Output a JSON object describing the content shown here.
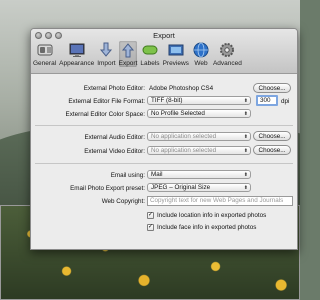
{
  "window": {
    "title": "Export"
  },
  "toolbar": {
    "items": [
      {
        "label": "General",
        "icon": "switch-icon"
      },
      {
        "label": "Appearance",
        "icon": "display-icon"
      },
      {
        "label": "Import",
        "icon": "import-arrow-icon"
      },
      {
        "label": "Export",
        "icon": "export-arrow-icon"
      },
      {
        "label": "Labels",
        "icon": "labels-icon"
      },
      {
        "label": "Previews",
        "icon": "previews-icon"
      },
      {
        "label": "Web",
        "icon": "globe-icon"
      },
      {
        "label": "Advanced",
        "icon": "gear-icon"
      }
    ],
    "active": "Export"
  },
  "editor": {
    "photo_editor_label": "External Photo Editor:",
    "photo_editor_value": "Adobe Photoshop CS4",
    "choose_label": "Choose...",
    "file_format_label": "External Editor File Format:",
    "file_format_value": "TIFF (8-bit)",
    "dpi_value": "300",
    "dpi_unit": "dpi",
    "color_space_label": "External Editor Color Space:",
    "color_space_value": "No Profile Selected"
  },
  "audio_video": {
    "audio_label": "External Audio Editor:",
    "audio_value": "No application selected",
    "video_label": "External Video Editor:",
    "video_value": "No application selected",
    "choose_label": "Choose..."
  },
  "email": {
    "email_using_label": "Email using:",
    "email_using_value": "Mail",
    "export_preset_label": "Email Photo Export preset:",
    "export_preset_value": "JPEG – Original Size",
    "web_copyright_label": "Web Copyright:",
    "web_copyright_placeholder": "Copyright text for new Web Pages and Journals",
    "include_location_label": "Include location info in exported photos",
    "include_location_checked": true,
    "include_face_label": "Include face info in exported photos",
    "include_face_checked": true,
    "check_mark": "✓"
  },
  "colors": {
    "accent": "#3b7fd6",
    "window_bg": "#ececec"
  }
}
